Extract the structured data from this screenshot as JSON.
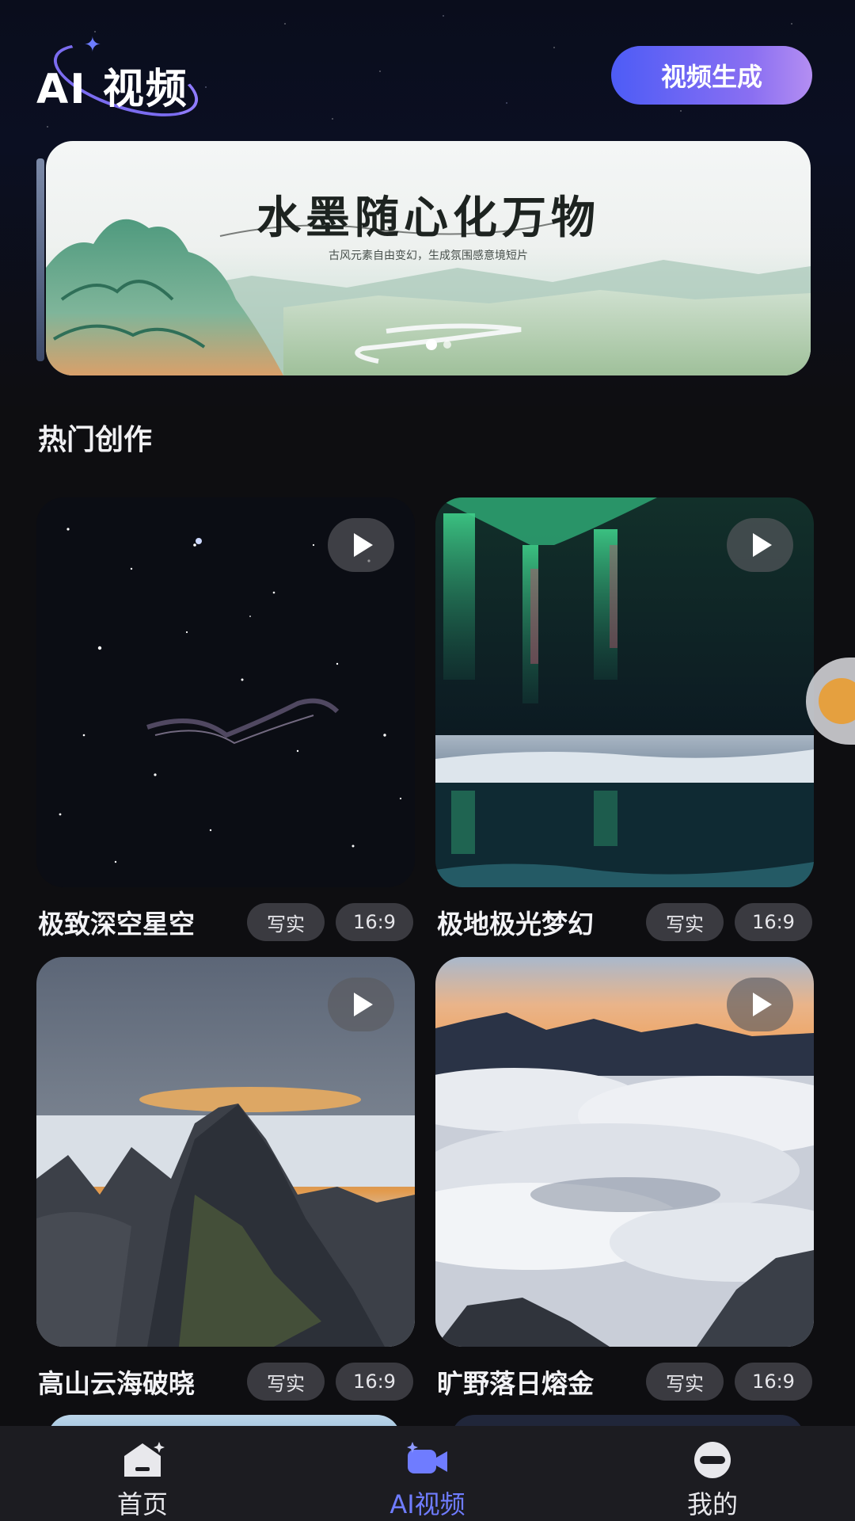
{
  "header": {
    "logo_text": "AI 视频",
    "generate_button": "视频生成"
  },
  "banner": {
    "title": "水墨随心化万物",
    "subtitle": "古风元素自由变幻，生成氛围感意境短片",
    "dots": 2,
    "active_dot": 1
  },
  "section": {
    "title": "热门创作"
  },
  "cards": [
    {
      "title": "极致深空星空",
      "style_tag": "写实",
      "ratio_tag": "16:9",
      "scene": "starry-sky"
    },
    {
      "title": "极地极光梦幻",
      "style_tag": "写实",
      "ratio_tag": "16:9",
      "scene": "aurora"
    },
    {
      "title": "高山云海破晓",
      "style_tag": "写实",
      "ratio_tag": "16:9",
      "scene": "mountain-sunrise"
    },
    {
      "title": "旷野落日熔金",
      "style_tag": "写实",
      "ratio_tag": "16:9",
      "scene": "sea-of-clouds"
    }
  ],
  "bottom_nav": {
    "items": [
      {
        "label": "首页",
        "icon": "home-icon",
        "active": false
      },
      {
        "label": "AI视频",
        "icon": "video-camera-icon",
        "active": true
      },
      {
        "label": "我的",
        "icon": "profile-icon",
        "active": false
      }
    ]
  },
  "colors": {
    "accent": "#6f7cff",
    "button_gradient_start": "#4d5cf6",
    "button_gradient_end": "#b48ef2",
    "background": "#0e0e11",
    "nav_background": "#1c1c21",
    "tag_background": "#3a3a40"
  }
}
